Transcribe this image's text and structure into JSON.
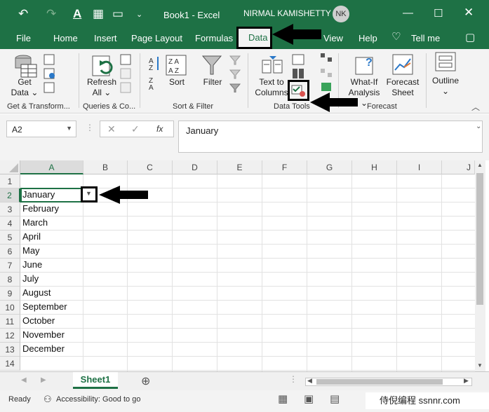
{
  "titlebar": {
    "doc_title": "Book1  -  Excel",
    "user_name": "NIRMAL KAMISHETTY",
    "user_initials": "NK"
  },
  "tabs": [
    "File",
    "Home",
    "Insert",
    "Page Layout",
    "Formulas",
    "Data",
    "View",
    "Help"
  ],
  "tell_me": "Tell me",
  "ribbon": {
    "get_data": [
      "Get",
      "Data"
    ],
    "group_get_transform": "Get & Transform...",
    "refresh": [
      "Refresh",
      "All"
    ],
    "group_queries": "Queries & Co...",
    "sort": "Sort",
    "filter": "Filter",
    "group_sort_filter": "Sort & Filter",
    "text_to_columns": [
      "Text to",
      "Columns"
    ],
    "group_data_tools": "Data Tools",
    "what_if": [
      "What-If",
      "Analysis"
    ],
    "forecast_sheet": [
      "Forecast",
      "Sheet"
    ],
    "group_forecast": "Forecast",
    "outline": "Outline"
  },
  "formula_bar": {
    "name_box": "A2",
    "fx": "fx",
    "formula": "January"
  },
  "grid": {
    "columns": [
      "A",
      "B",
      "C",
      "D",
      "E",
      "F",
      "G",
      "H",
      "I",
      "J"
    ],
    "rows": [
      "1",
      "2",
      "3",
      "4",
      "5",
      "6",
      "7",
      "8",
      "9",
      "10",
      "11",
      "12",
      "13",
      "14"
    ],
    "column_a_values": [
      "",
      "January",
      "February",
      "March",
      "April",
      "May",
      "June",
      "July",
      "August",
      "September",
      "October",
      "November",
      "December",
      ""
    ]
  },
  "sheet_tab": "Sheet1",
  "status": {
    "ready": "Ready",
    "accessibility": "Accessibility: Good to go"
  },
  "watermark": "侍倪编程 ssnnr.com"
}
